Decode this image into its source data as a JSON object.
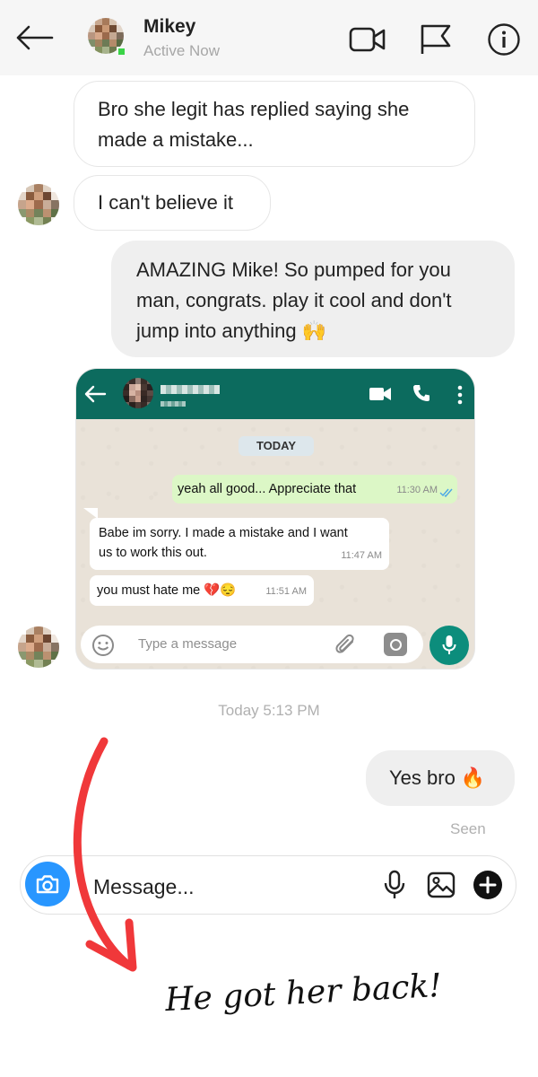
{
  "header": {
    "contact_name": "Mikey",
    "status": "Active Now"
  },
  "messages": [
    {
      "sender": "them",
      "text_line1": "Bro she legit has replied saying she",
      "text_line2": "made a mistake..."
    },
    {
      "sender": "them",
      "text": "I can't believe it"
    },
    {
      "sender": "me",
      "text_line1": "AMAZING Mike! So pumped for you",
      "text_line2": "man, congrats. play it cool and don't",
      "text_line3": "jump into anything 🙌"
    }
  ],
  "whatsapp": {
    "date_label": "TODAY",
    "messages": [
      {
        "direction": "out",
        "text": "yeah all good... Appreciate that",
        "time": "11:30 AM"
      },
      {
        "direction": "in",
        "text_line1": "Babe im sorry. I made a mistake and I want",
        "text_line2": "us to work this out.",
        "time": "11:47 AM"
      },
      {
        "direction": "in",
        "text": "you must hate me 💔😔",
        "time": "11:51 AM"
      }
    ],
    "input_placeholder": "Type a message"
  },
  "timestamp": "Today 5:13 PM",
  "reply": {
    "text": "Yes bro 🔥"
  },
  "seen_label": "Seen",
  "composer": {
    "placeholder": "Message..."
  },
  "caption": "He got her back!",
  "colors": {
    "accent_blue": "#2896ff",
    "whatsapp_green": "#0c6b5e",
    "arrow_red": "#f0383a",
    "online_green": "#3ad447"
  }
}
